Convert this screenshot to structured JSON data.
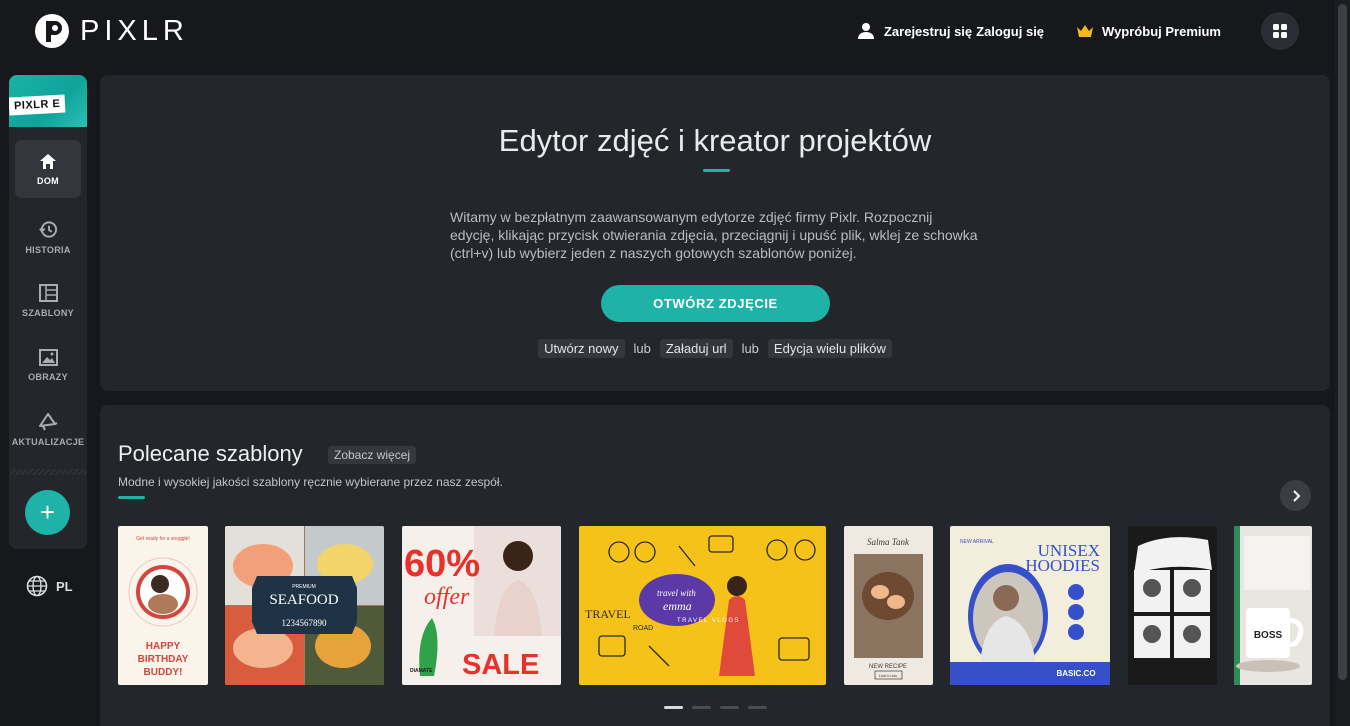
{
  "brand": {
    "name": "PIXLR",
    "accent": "#1fb2a7"
  },
  "header": {
    "register_label": "Zarejestruj się",
    "login_label": "Zaloguj się",
    "premium_label": "Wypróbuj Premium",
    "icons": [
      "user-icon",
      "crown-icon",
      "apps-grid-icon"
    ]
  },
  "sidebar": {
    "app_badge": "PIXLR E",
    "items": [
      {
        "label": "DOM",
        "icon": "home-icon",
        "active": true
      },
      {
        "label": "HISTORIA",
        "icon": "history-icon"
      },
      {
        "label": "SZABLONY",
        "icon": "templates-icon"
      },
      {
        "label": "OBRAZY",
        "icon": "image-icon"
      },
      {
        "label": "AKTUALIZACJE",
        "icon": "megaphone-icon"
      }
    ],
    "add_label": "+",
    "language": "PL"
  },
  "hero": {
    "title": "Edytor zdjęć i kreator projektów",
    "description": "Witamy w bezpłatnym zaawansowanym edytorze zdjęć firmy Pixlr. Rozpocznij edycję, klikając przycisk otwierania zdjęcia, przeciągnij i upuść plik, wklej ze schowka (ctrl+v) lub wybierz jeden z naszych gotowych szablonów poniżej.",
    "open_button": "OTWÓRZ ZDJĘCIE",
    "links": {
      "create_new": "Utwórz nowy",
      "or1": "lub",
      "load_url": "Załaduj url",
      "or2": "lub",
      "batch": "Edycja wielu plików"
    }
  },
  "templates": {
    "title": "Polecane szablony",
    "see_more": "Zobacz więcej",
    "subtitle": "Modne i wysokiej jakości szablony ręcznie wybierane przez nasz zespół.",
    "cards": [
      {
        "name": "birthday",
        "texts": [
          "Get ready for a snuggle!",
          "HAPPY",
          "BIRTHDAY",
          "BUDDY!"
        ]
      },
      {
        "name": "seafood",
        "texts": [
          "PREMIUM",
          "SEAFOOD",
          "1234567890"
        ]
      },
      {
        "name": "sale",
        "texts": [
          "60%",
          "offer",
          "SALE",
          "DIAMATE"
        ]
      },
      {
        "name": "travel",
        "texts": [
          "travel with",
          "emma",
          "TRAVEL VLOGS",
          "TRAVEL",
          "ROAD"
        ]
      },
      {
        "name": "recipe",
        "texts": [
          "Salma Tank",
          "NEW RECIPE",
          "Link in bio"
        ]
      },
      {
        "name": "hoodies",
        "texts": [
          "NEW ARRIVAL",
          "UNISEX",
          "HOODIES",
          "BASIC.CO"
        ]
      },
      {
        "name": "collage",
        "texts": []
      },
      {
        "name": "mug",
        "texts": [
          "BOSS"
        ]
      }
    ],
    "pagination": {
      "pages": 4,
      "current": 1
    }
  }
}
